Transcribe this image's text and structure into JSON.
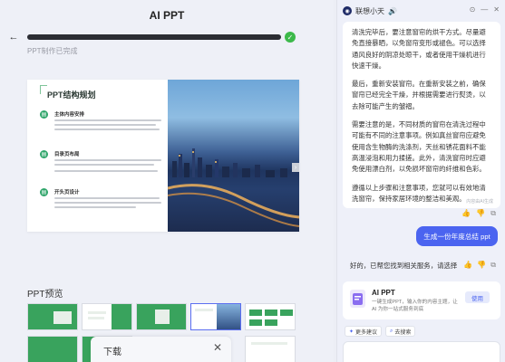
{
  "app": {
    "title": "AI PPT"
  },
  "progress": {
    "value": 1.0,
    "status": "PPT制作已完成"
  },
  "slide": {
    "title": "PPT结构规划",
    "sections": [
      {
        "heading": "主体内容安排"
      },
      {
        "heading": "目录页布局"
      },
      {
        "heading": "开头页设计"
      }
    ]
  },
  "preview": {
    "label": "PPT预览"
  },
  "download": {
    "title": "下载",
    "close_glyph": "✕"
  },
  "chat": {
    "bot_name": "联想小天",
    "bubble": {
      "paragraphs": [
        "清洗完毕后，要注意窗帘的烘干方式。尽量避免直接暴晒，以免窗帘变形或褪色。可以选择通风良好的阴凉处晾干，或者使用干燥机进行快速干燥。",
        "最后，重新安装窗帘。在重新安装之前，确保窗帘已经完全干燥，并根据需要进行熨烫，以去除可能产生的皱褶。",
        "需要注意的是，不同材质的窗帘在清洗过程中可能有不同的注意事项。例如真丝窗帘应避免使用含生物酶的洗涤剂，天丝和锈花面料不能高温浸泡和用力揉搓。此外，清洗窗帘时应避免使用漂白剂，以免损坏窗帘的纤维和色彩。",
        "遵循以上步骤和注意事项，您就可以有效地清洗窗帘，保持家居环境的整洁和美观。"
      ],
      "ai_note": "内容由AI生成"
    },
    "user_message": "生成一份年度总结 ppt",
    "reply": "好的，已帮您找到相关服务，请选择",
    "card": {
      "title": "AI PPT",
      "description": "一键生成PPT，输入你的内容主题，让 AI 为你一站式服务到底",
      "button": "使用"
    },
    "chips": [
      {
        "label": "更多建议",
        "icon": "sparkle-icon"
      },
      {
        "label": "去搜索",
        "icon": "search-icon"
      }
    ]
  },
  "colors": {
    "accent": "#4b64f0",
    "success": "#3cb94a",
    "slide_green": "#2fa56a"
  }
}
